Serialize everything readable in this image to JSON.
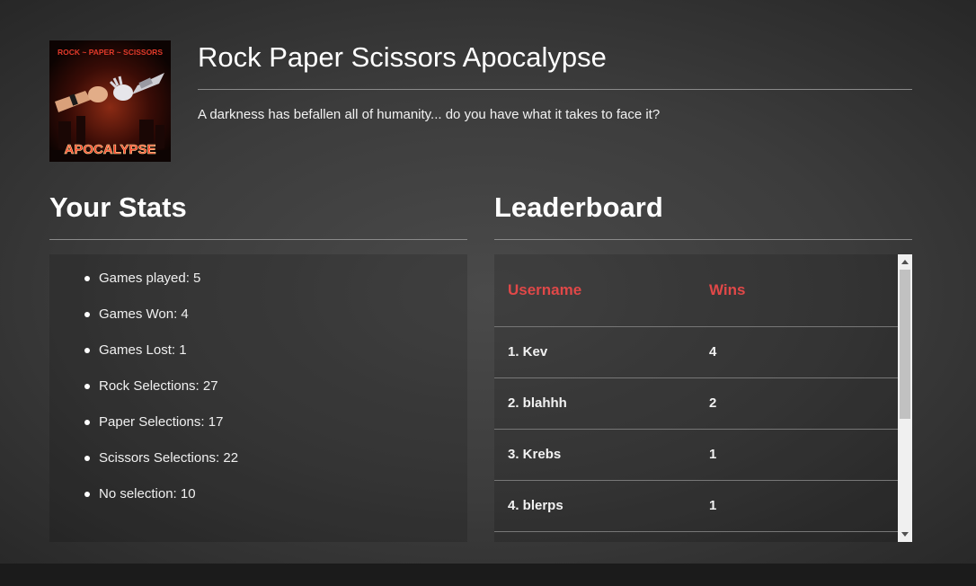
{
  "header": {
    "title": "Rock Paper Scissors Apocalypse",
    "tagline": "A darkness has befallen all of humanity... do you have what it takes to face it?",
    "logo": {
      "top_text": "ROCK ~ PAPER ~ SCISSORS",
      "bottom_text": "APOCALYPSE"
    }
  },
  "stats": {
    "heading": "Your Stats",
    "items": [
      "Games played: 5",
      "Games Won: 4",
      "Games Lost: 1",
      "Rock Selections: 27",
      "Paper Selections: 17",
      "Scissors Selections: 22",
      "No selection: 10"
    ]
  },
  "leaderboard": {
    "heading": "Leaderboard",
    "columns": [
      "Username",
      "Wins"
    ],
    "rows": [
      {
        "user": "1. Kev",
        "wins": "4"
      },
      {
        "user": "2. blahhh",
        "wins": "2"
      },
      {
        "user": "3. Krebs",
        "wins": "1"
      },
      {
        "user": "4. blerps",
        "wins": "1"
      }
    ]
  },
  "colors": {
    "accent": "#e04848",
    "rule": "#8a8a8a",
    "background": "#3c3c3c"
  }
}
